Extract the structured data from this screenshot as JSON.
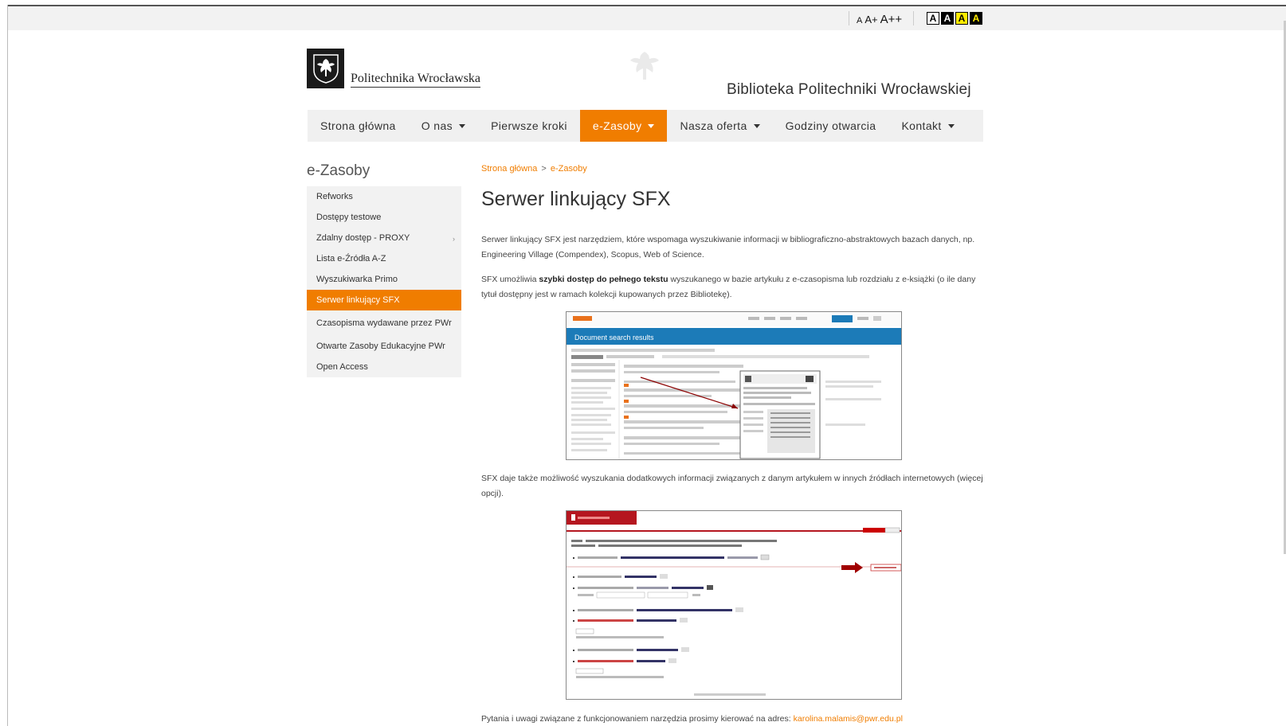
{
  "toolbar": {
    "font_small": "A",
    "font_medium": "A+",
    "font_large": "A++",
    "contrast_options": [
      "A",
      "A",
      "A",
      "A"
    ]
  },
  "header": {
    "logo_text": "Politechnika Wrocławska",
    "library_title": "Biblioteka Politechniki Wrocławskiej"
  },
  "nav": {
    "items": [
      {
        "label": "Strona główna",
        "has_dropdown": false
      },
      {
        "label": "O nas",
        "has_dropdown": true
      },
      {
        "label": "Pierwsze kroki",
        "has_dropdown": false
      },
      {
        "label": "e-Zasoby",
        "has_dropdown": true,
        "active": true
      },
      {
        "label": "Nasza oferta",
        "has_dropdown": true
      },
      {
        "label": "Godziny otwarcia",
        "has_dropdown": false
      },
      {
        "label": "Kontakt",
        "has_dropdown": true
      }
    ]
  },
  "sidebar": {
    "title": "e-Zasoby",
    "items": [
      {
        "label": "Refworks"
      },
      {
        "label": "Dostępy testowe"
      },
      {
        "label": "Zdalny dostęp - PROXY",
        "has_submenu": true
      },
      {
        "label": "Lista e-Źródła A-Z"
      },
      {
        "label": "Wyszukiwarka Primo"
      },
      {
        "label": "Serwer linkujący SFX",
        "active": true
      },
      {
        "label": "Czasopisma wydawane przez PWr"
      },
      {
        "label": "Otwarte Zasoby Edukacyjne PWr"
      },
      {
        "label": "Open Access"
      }
    ]
  },
  "breadcrumb": {
    "home": "Strona główna",
    "current": "e-Zasoby",
    "separator": ">"
  },
  "main": {
    "title": "Serwer linkujący SFX",
    "para1": "Serwer linkujący SFX jest narzędziem, które wspomaga wyszukiwanie informacji w bibliograficzno-abstraktowych bazach danych, np. Engineering Village (Compendex), Scopus, Web of Science.",
    "para2_before": "SFX umożliwia ",
    "para2_bold": "szybki dostęp do pełnego tekstu",
    "para2_after": " wyszukanego w bazie artykułu z e-czasopisma lub rozdziału z e-książki (o ile dany tytuł dostępny jest w ramach kolekcji kupowanych przez Bibliotekę).",
    "screenshot1_label": "Document search results",
    "para3": "SFX daje także możliwość wyszukania  dodatkowych informacji związanych z danym artykułem w innych źródłach internetowych (więcej opcji).",
    "para4_before": "Pytania i uwagi związane z funkcjonowaniem narzędzia prosimy kierować na adres: ",
    "contact_email": "karolina.malamis@pwr.edu.pl"
  },
  "colors": {
    "accent": "#f07d00",
    "nav_bg": "#f0f0f0",
    "sidebar_bg": "#f2f2f2",
    "scopus_bar": "#1c7bb8",
    "sfx_red": "#b5161f"
  }
}
